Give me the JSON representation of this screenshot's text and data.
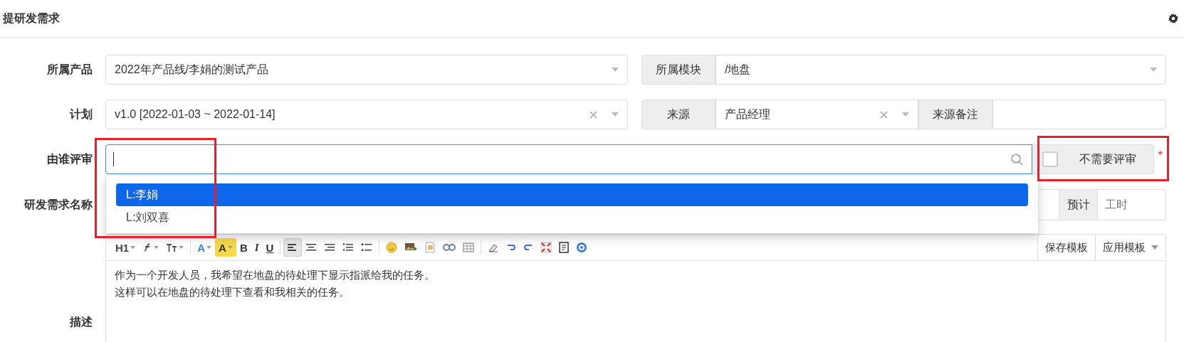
{
  "header": {
    "title": "提研发需求"
  },
  "product": {
    "label": "所属产品",
    "value": "2022年产品线/李娟的测试产品"
  },
  "module": {
    "label": "所属模块",
    "value": "/地盘"
  },
  "plan": {
    "label": "计划",
    "value": "v1.0 [2022-01-03 ~ 2022-01-14]"
  },
  "source": {
    "label": "来源",
    "value": "产品经理"
  },
  "source_note": {
    "label": "来源备注"
  },
  "reviewer": {
    "label": "由谁评审",
    "required_mark": "*",
    "options": [
      {
        "label": "L:李娟",
        "selected": true
      },
      {
        "label": "L:刘双喜",
        "selected": false
      }
    ],
    "no_review": {
      "label": "不需要评审",
      "checked": false
    }
  },
  "name": {
    "label": "研发需求名称"
  },
  "estimate": {
    "label": "预计",
    "placeholder": "工时"
  },
  "description": {
    "label": "描述",
    "toolbar": [
      {
        "kind": "glyph",
        "label": "H1"
      },
      {
        "kind": "icon"
      },
      {
        "kind": "icon"
      },
      {
        "kind": "separator"
      },
      {
        "kind": "glyph",
        "label": "A"
      },
      {
        "kind": "glyph",
        "label": "A"
      },
      {
        "kind": "glyph",
        "label": "B"
      },
      {
        "kind": "glyph",
        "label": "I"
      },
      {
        "kind": "glyph",
        "label": "U"
      },
      {
        "kind": "separator"
      },
      {
        "kind": "icon",
        "active": true
      },
      {
        "kind": "icon",
        "active": false
      },
      {
        "kind": "icon",
        "active": false
      },
      {
        "kind": "icon",
        "active": false
      },
      {
        "kind": "icon",
        "active": false
      },
      {
        "kind": "separator"
      },
      {
        "kind": "icon"
      },
      {
        "kind": "icon"
      },
      {
        "kind": "icon"
      },
      {
        "kind": "icon"
      },
      {
        "kind": "icon"
      },
      {
        "kind": "separator"
      },
      {
        "kind": "icon"
      },
      {
        "kind": "icon"
      },
      {
        "kind": "icon"
      },
      {
        "kind": "icon"
      },
      {
        "kind": "icon"
      },
      {
        "kind": "icon"
      }
    ],
    "template_buttons": [
      "保存模板",
      "应用模板"
    ],
    "lines": [
      "作为一个开发人员，我希望在地盘的待处理下显示指派给我的任务。",
      "这样可以在地盘的待处理下查看和我相关的任务。"
    ]
  }
}
